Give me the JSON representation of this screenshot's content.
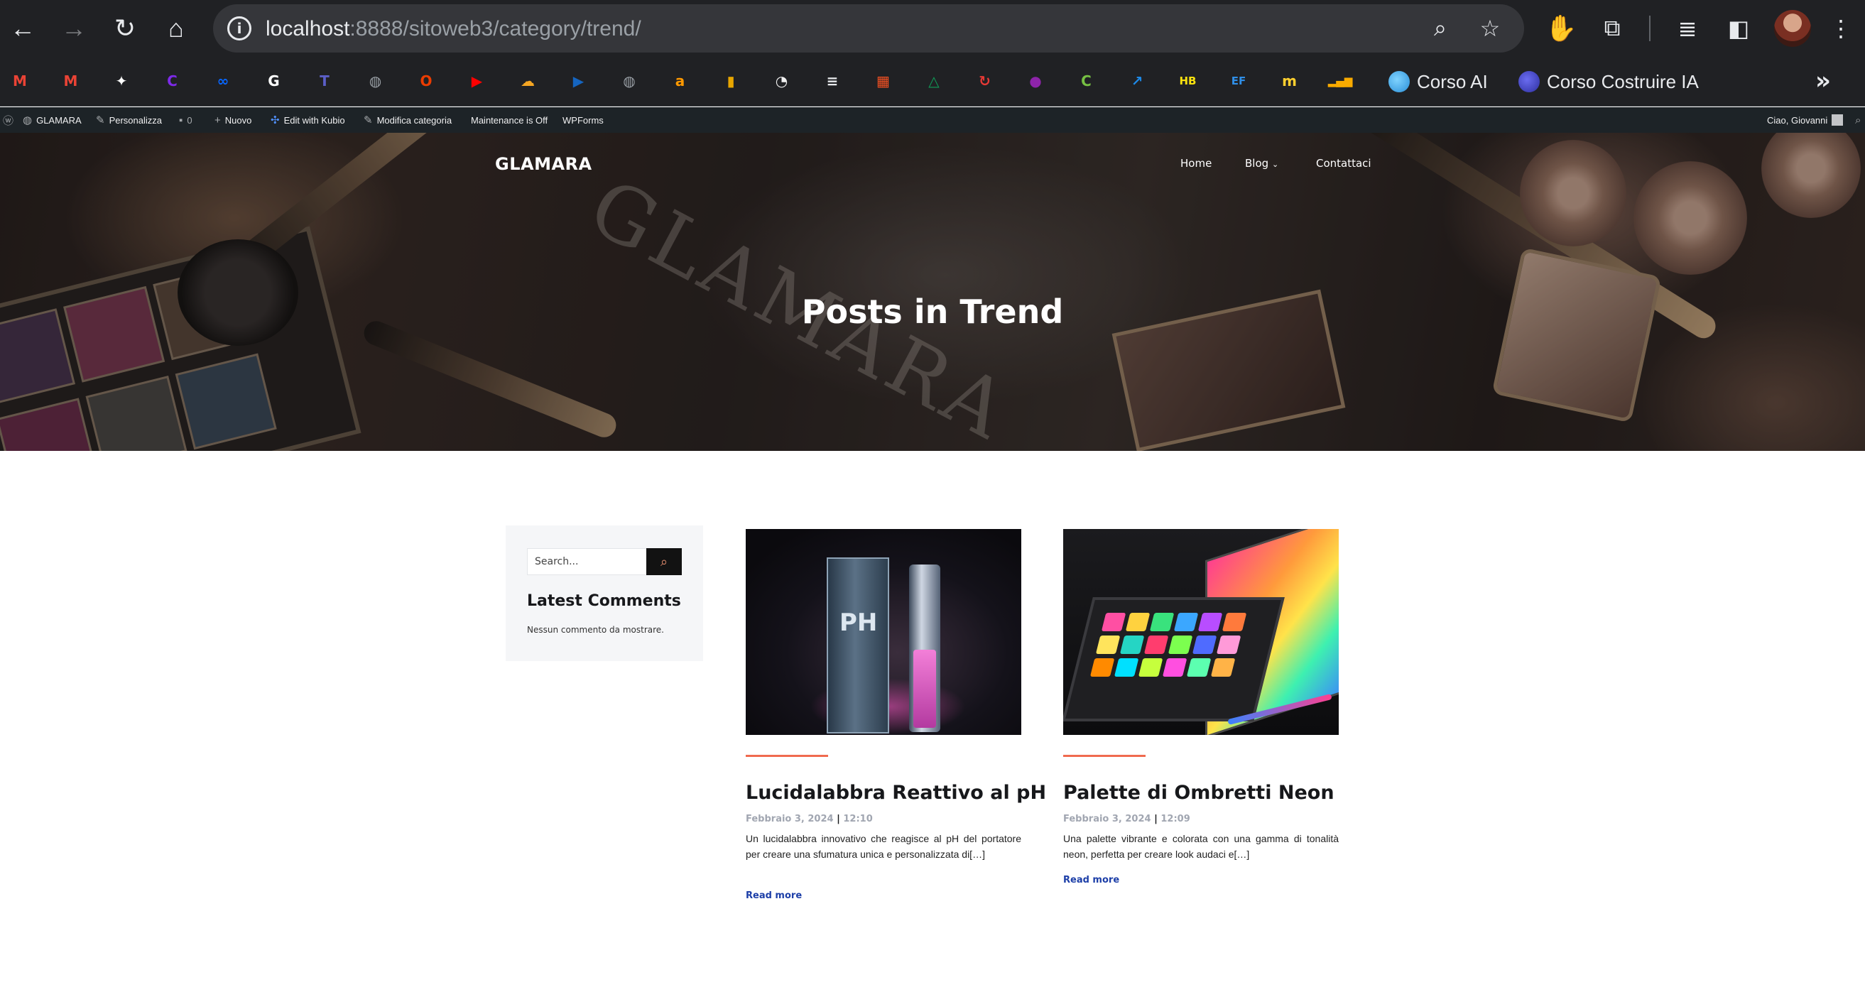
{
  "browser": {
    "url_host": "localhost",
    "url_path": ":8888/sitoweb3/category/trend/",
    "bookmarks": [
      {
        "icon": "gmail-icon",
        "color": "#ea4335",
        "glyph": "M"
      },
      {
        "icon": "gmail-icon",
        "color": "#ea4335",
        "glyph": "M"
      },
      {
        "icon": "chatgpt-icon",
        "color": "#ffffff",
        "glyph": "✦"
      },
      {
        "icon": "canva-icon",
        "color": "#7d2ae8",
        "glyph": "C"
      },
      {
        "icon": "meta-icon",
        "color": "#0866ff",
        "glyph": "∞"
      },
      {
        "icon": "google-icon",
        "color": "#ffffff",
        "glyph": "G"
      },
      {
        "icon": "teams-icon",
        "color": "#5b5fc7",
        "glyph": "T"
      },
      {
        "icon": "globe-icon",
        "color": "#9aa0a6",
        "glyph": "◍"
      },
      {
        "icon": "office-icon",
        "color": "#eb3c00",
        "glyph": "O"
      },
      {
        "icon": "youtube-icon",
        "color": "#ff0000",
        "glyph": "▶"
      },
      {
        "icon": "cloud-icon",
        "color": "#f5a623",
        "glyph": "☁"
      },
      {
        "icon": "play-icon",
        "color": "#1565c0",
        "glyph": "▶"
      },
      {
        "icon": "globe-icon",
        "color": "#9aa0a6",
        "glyph": "◍"
      },
      {
        "icon": "amazon-icon",
        "color": "#ff9900",
        "glyph": "a"
      },
      {
        "icon": "bag-icon",
        "color": "#e8a600",
        "glyph": "▮"
      },
      {
        "icon": "clock-icon",
        "color": "#f1f1f1",
        "glyph": "◔"
      },
      {
        "icon": "doc-icon",
        "color": "#e8eaed",
        "glyph": "≡"
      },
      {
        "icon": "microsoft-icon",
        "color": "#f25022",
        "glyph": "▦"
      },
      {
        "icon": "drive-icon",
        "color": "#0f9d58",
        "glyph": "△"
      },
      {
        "icon": "sync-icon",
        "color": "#e53935",
        "glyph": "↻"
      },
      {
        "icon": "shape-icon",
        "color": "#8e24aa",
        "glyph": "●"
      },
      {
        "icon": "c-icon",
        "color": "#76c043",
        "glyph": "C"
      },
      {
        "icon": "chart-line-icon",
        "color": "#1e88e5",
        "glyph": "↗"
      },
      {
        "icon": "hb-icon",
        "color": "#f9e20e",
        "glyph": "HB"
      },
      {
        "icon": "ef-icon",
        "color": "#2f8fe8",
        "glyph": "EF"
      },
      {
        "icon": "miro-icon",
        "color": "#ffd02f",
        "glyph": "m"
      },
      {
        "icon": "analytics-icon",
        "color": "#f9ab00",
        "glyph": "▂▄▆"
      }
    ],
    "bookmark_labels": {
      "corso_ai": "Corso AI",
      "corso_costruire_ia": "Corso Costruire IA"
    }
  },
  "admin_bar": {
    "site_name": "GLAMARA",
    "customize": "Personalizza",
    "comments_count": "0",
    "new": "Nuovo",
    "edit_kubio": "Edit with Kubio",
    "edit_category": "Modifica categoria",
    "maintenance": "Maintenance is Off",
    "wpforms": "WPForms",
    "greeting": "Ciao, Giovanni"
  },
  "site": {
    "logo": "GLAMARA",
    "nav": {
      "home": "Home",
      "blog": "Blog",
      "contact": "Contattaci"
    },
    "hero_watermark": "GLAMARA",
    "hero_title": "Posts in Trend"
  },
  "sidebar": {
    "search_placeholder": "Search...",
    "widget_title": "Latest Comments",
    "widget_text": "Nessun commento da mostrare."
  },
  "posts": [
    {
      "title": "Lucidalabbra Reattivo al pH",
      "date": "Febbraio 3, 2024",
      "time": "12:10",
      "excerpt": "Un lucidalabbra innovativo che reagisce al pH del portatore per creare una sfumatura unica e personalizzata di[…]",
      "read_more": "Read more",
      "image_label": "PH"
    },
    {
      "title": "Palette di Ombretti Neon",
      "date": "Febbraio 3, 2024",
      "time": "12:09",
      "excerpt": "Una palette vibrante e colorata con una gamma di tonalità neon, perfetta per creare look audaci e[…]",
      "read_more": "Read more"
    }
  ],
  "colors": {
    "accent_rule": "#f06a4f",
    "read_more": "#1d3fa8",
    "meta": "#a1a6b1"
  }
}
